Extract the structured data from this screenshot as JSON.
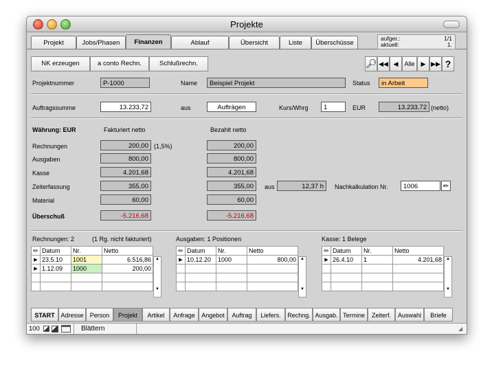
{
  "window": {
    "title": "Projekte"
  },
  "tabs": [
    "Projekt",
    "Jobs/Phasen",
    "Finanzen",
    "Ablauf",
    "Übersicht",
    "Liste",
    "Überschüsse"
  ],
  "record_info": {
    "aufger_label": "aufger.:",
    "aufger_value": "1/1",
    "aktuell_label": "aktuell:",
    "aktuell_value": "1."
  },
  "actions": {
    "nk": "NK erzeugen",
    "aconto": "a conto Rechn.",
    "schluss": "Schlußrechn."
  },
  "nav": {
    "alle": "Alle",
    "help": "?"
  },
  "header": {
    "projektnummer_label": "Projektnummer",
    "projektnummer": "P-1000",
    "name_label": "Name",
    "name": "Beispiel Projekt",
    "status_label": "Status",
    "status": "in Arbeit",
    "auftragssumme_label": "Auftragssumme",
    "auftragssumme": "13.233,72",
    "aus_label": "aus",
    "aus_value": "Aufträgen",
    "kurs_label": "Kurs/Whrg",
    "kurs": "1",
    "eur_label": "EUR",
    "eur_value": "13.233,72",
    "netto": "(netto)"
  },
  "finance": {
    "waehrung": "Währung: EUR",
    "fakt_label": "Fakturiert netto",
    "bez_label": "Bezahlt netto",
    "rows": [
      {
        "label": "Rechnungen",
        "fakturiert": "200,00",
        "note": "(1,5%)",
        "bezahlt": "200,00"
      },
      {
        "label": "Ausgaben",
        "fakturiert": "800,00",
        "note": "",
        "bezahlt": "800,00"
      },
      {
        "label": "Kasse",
        "fakturiert": "4.201,68",
        "note": "",
        "bezahlt": "4.201,68"
      },
      {
        "label": "Zeiterfassung",
        "fakturiert": "355,00",
        "note": "",
        "bezahlt": "355,00"
      },
      {
        "label": "Material",
        "fakturiert": "60,00",
        "note": "",
        "bezahlt": "60,00"
      }
    ],
    "ueberschuss_label": "Überschuß",
    "ueberschuss_fakt": "-5.216,68",
    "ueberschuss_bez": "-5.216,68",
    "aus_label": "aus",
    "hours": "12,37 h",
    "nachkalk_label": "Nachkalkulation Nr.",
    "nachkalk": "1006"
  },
  "lists": {
    "rechnungen": {
      "title": "Rechnungen: 2",
      "subtitle": "(1 Rg. nicht fakturiert)",
      "headers": [
        "Datum",
        "Nr.",
        "Netto"
      ],
      "rows": [
        {
          "datum": "23.5.10",
          "nr": "1001",
          "netto": "6.516,86",
          "color": "#fff8c0"
        },
        {
          "datum": "1.12.09",
          "nr": "1000",
          "netto": "200,00",
          "color": "#c8f0c0"
        }
      ]
    },
    "ausgaben": {
      "title": "Ausgaben: 1 Positionen",
      "headers": [
        "Datum",
        "Nr.",
        "Netto"
      ],
      "rows": [
        {
          "datum": "10.12.20",
          "nr": "1000",
          "netto": "800,00"
        }
      ]
    },
    "kasse": {
      "title": "Kasse: 1 Belege",
      "headers": [
        "Datum",
        "Nr.",
        "Netto"
      ],
      "rows": [
        {
          "datum": "26.4.10",
          "nr": "1",
          "netto": "4.201,68"
        }
      ]
    }
  },
  "bottom_tabs": [
    "START",
    "Adresse",
    "Person",
    "Projekt",
    "Artikel",
    "Anfrage",
    "Angebot",
    "Auftrag",
    "Liefers.",
    "Rechng.",
    "Ausgab.",
    "Termine",
    "Zeiterf.",
    "Auswahl",
    "Briefe"
  ],
  "statusbar": {
    "zoom": "100",
    "mode": "Blättern"
  },
  "colors": {
    "status_bg": "#ffc98a",
    "overflow_text": "#c00000",
    "active_bottom_tab": "#a9a9a9"
  }
}
